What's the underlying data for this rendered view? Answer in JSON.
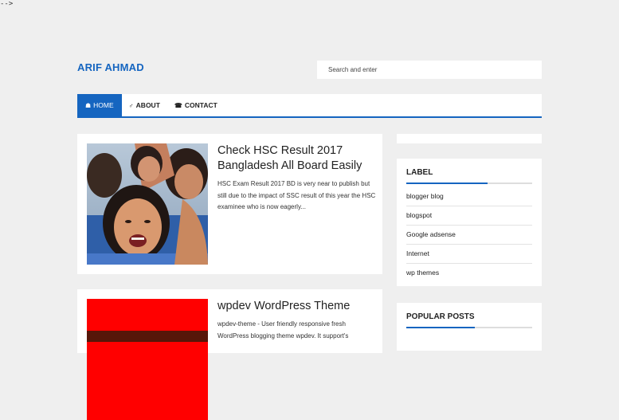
{
  "stray_text": "-->",
  "site": {
    "title": "ARIF AHMAD"
  },
  "search": {
    "placeholder": "Search and enter"
  },
  "nav": {
    "items": [
      {
        "label": "HOME",
        "icon": "home-icon",
        "glyph": "☗"
      },
      {
        "label": "ABOUT",
        "icon": "male-icon",
        "glyph": "♂"
      },
      {
        "label": "CONTACT",
        "icon": "phone-icon",
        "glyph": "☎"
      }
    ]
  },
  "posts": [
    {
      "title": "Check HSC Result 2017 Bangladesh All Board Easily",
      "snippet": "HSC Exam Result 2017 BD is very near to publish but still due to the impact of SSC result of this year the HSC examinee who is now eagerly..."
    },
    {
      "title": "wpdev WordPress Theme",
      "snippet": "wpdev-theme - User friendly responsive fresh WordPress blogging theme wpdev. It support's"
    }
  ],
  "sidebar": {
    "label_widget": {
      "title": "LABEL",
      "items": [
        "blogger blog",
        "blogspot",
        "Google adsense",
        "Internet",
        "wp themes"
      ]
    },
    "popular_widget": {
      "title": "POPULAR POSTS"
    }
  },
  "colors": {
    "accent": "#1565c0",
    "background": "#efefef",
    "thumb2": "#ff0000"
  }
}
